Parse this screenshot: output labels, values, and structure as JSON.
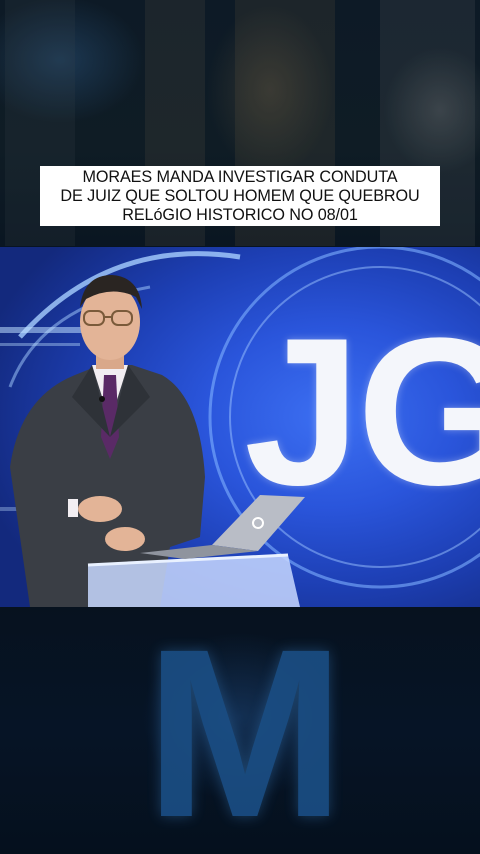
{
  "headline": {
    "lines": [
      "MORAES MANDA INVESTIGAR CONDUTA",
      "DE JUIZ QUE SOLTOU HOMEM QUE QUEBROU",
      "RELóGIO HISTORICO NO 08/01"
    ]
  },
  "video": {
    "logo": "JG",
    "accent_color": "#2a55db"
  },
  "background": {
    "watermark": "M"
  },
  "icons": [
    "laptop-logo-icon"
  ]
}
